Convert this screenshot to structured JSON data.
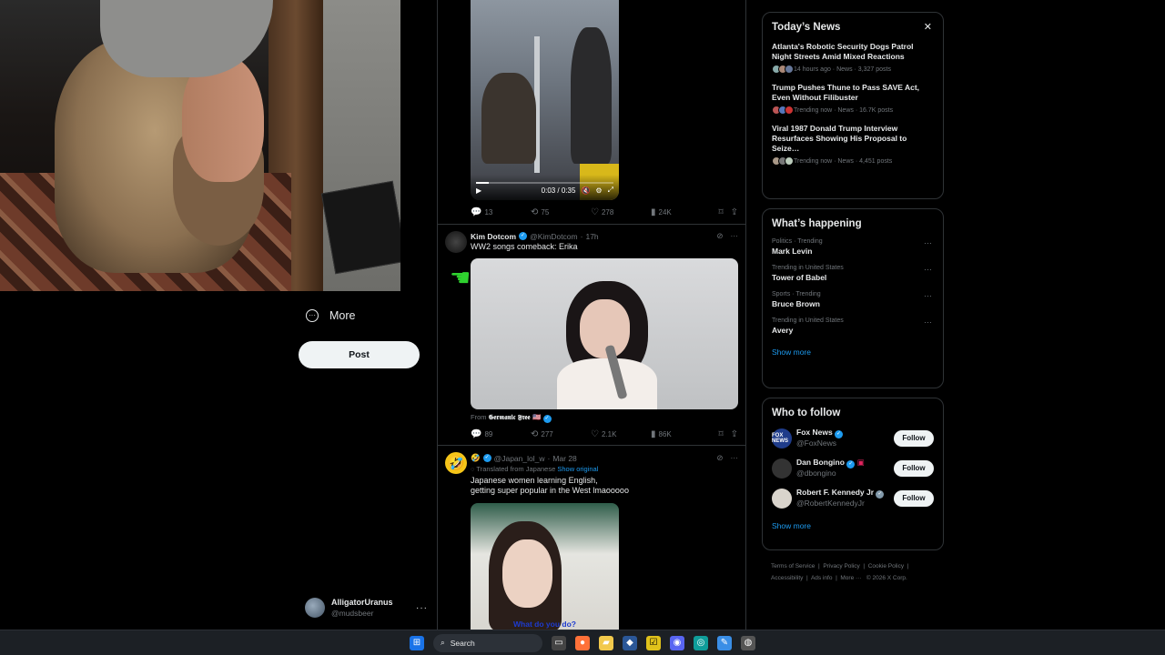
{
  "left_nav": {
    "more_label": "More",
    "post_label": "Post",
    "account": {
      "display_name": "AlligatorUranus",
      "handle": "@mudsbeer"
    }
  },
  "feed": {
    "tweet1": {
      "video_time": "0:03 / 0:35",
      "progress": 0.09,
      "stats": {
        "replies": "13",
        "reposts": "75",
        "likes": "278",
        "views": "24K"
      }
    },
    "tweet2": {
      "name": "Kim Dotcom",
      "handle": "@KimDotcom",
      "time": "17h",
      "text": "WW2 songs comeback: Erika",
      "from_prefix": "From",
      "from_name": "𝕲𝖊𝖗𝖒𝖆𝖓𝖎𝖈 𝕱𝖗𝖊𝖊 🇺🇸",
      "stats": {
        "replies": "89",
        "reposts": "277",
        "likes": "2.1K",
        "views": "86K"
      }
    },
    "tweet3": {
      "name_emoji": "🤣",
      "handle": "@Japan_lol_w",
      "time": "Mar 28",
      "translated_label": "Translated from Japanese",
      "show_original": "Show original",
      "text_line1": "Japanese women learning English,",
      "text_line2": "getting super popular in the West lmaooooo",
      "caption": "What do you do?"
    }
  },
  "todays_news": {
    "title": "Today’s News",
    "items": [
      {
        "title": "Atlanta's Robotic Security Dogs Patrol Night Streets Amid Mixed Reactions",
        "meta": "14 hours ago · News · 3,327 posts"
      },
      {
        "title": "Trump Pushes Thune to Pass SAVE Act, Even Without Filibuster",
        "meta": "Trending now · News · 16.7K posts"
      },
      {
        "title": "Viral 1987 Donald Trump Interview Resurfaces Showing His Proposal to Seize…",
        "meta": "Trending now · News · 4,451 posts"
      }
    ]
  },
  "whats_happening": {
    "title": "What’s happening",
    "trends": [
      {
        "context": "Politics · Trending",
        "name": "Mark Levin"
      },
      {
        "context": "Trending in United States",
        "name": "Tower of Babel"
      },
      {
        "context": "Sports · Trending",
        "name": "Bruce Brown"
      },
      {
        "context": "Trending in United States",
        "name": "Avery"
      }
    ],
    "show_more": "Show more"
  },
  "who_to_follow": {
    "title": "Who to follow",
    "accounts": [
      {
        "name": "Fox News",
        "handle": "@FoxNews",
        "avatar_text": "FOX NEWS"
      },
      {
        "name": "Dan Bongino",
        "handle": "@dbongino"
      },
      {
        "name": "Robert F. Kennedy Jr",
        "handle": "@RobertKennedyJr"
      }
    ],
    "follow_label": "Follow",
    "show_more": "Show more"
  },
  "footer": {
    "links": [
      "Terms of Service",
      "Privacy Policy",
      "Cookie Policy",
      "Accessibility",
      "Ads info",
      "More ···",
      "© 2026 X Corp."
    ]
  },
  "taskbar": {
    "search_label": "Search"
  },
  "colors": {
    "accent": "#1d9bf0",
    "background": "#000000",
    "border": "#2f3336",
    "muted": "#71767b"
  }
}
